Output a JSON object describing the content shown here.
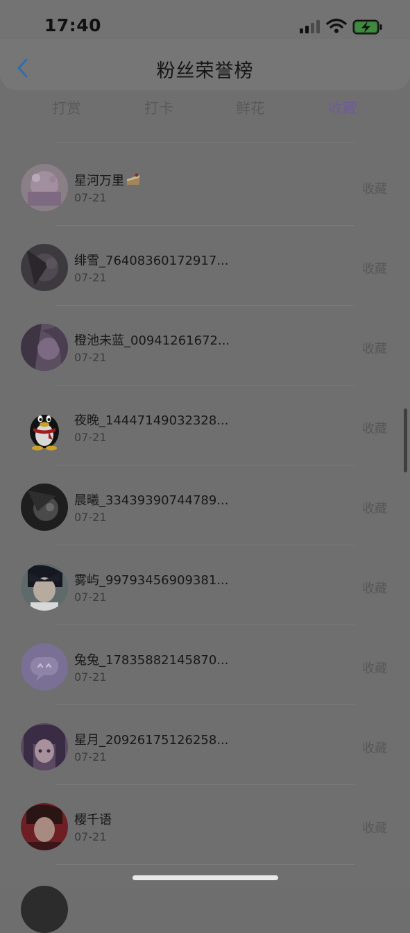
{
  "status_bar": {
    "time": "17:40",
    "icons": [
      "signal-icon",
      "wifi-icon",
      "battery-charging-icon"
    ]
  },
  "header": {
    "title": "粉丝荣誉榜",
    "back_icon": "chevron-left-icon"
  },
  "tabs": [
    {
      "label": "打赏",
      "active": false
    },
    {
      "label": "打卡",
      "active": false
    },
    {
      "label": "鲜花",
      "active": false
    },
    {
      "label": "收藏",
      "active": true
    }
  ],
  "colors": {
    "accent": "#6f5d93",
    "back_icon": "#2b6fb0",
    "page_bg": "#6f6f6f"
  },
  "fans": [
    {
      "name": "星河万里",
      "date": "07-21",
      "action": "收藏",
      "avatar": "pink-anime-avatar",
      "badge": "cake-emoji"
    },
    {
      "name": "绯雪_76408360172917...",
      "date": "07-21",
      "action": "收藏",
      "avatar": "dark-anime-avatar"
    },
    {
      "name": "橙池未蓝_00941261672...",
      "date": "07-21",
      "action": "收藏",
      "avatar": "purple-anime-avatar"
    },
    {
      "name": "夜晚_14447149032328...",
      "date": "07-21",
      "action": "收藏",
      "avatar": "penguin-avatar"
    },
    {
      "name": "晨曦_33439390744789...",
      "date": "07-21",
      "action": "收藏",
      "avatar": "monochrome-anime-avatar"
    },
    {
      "name": "雾屿_99793456909381...",
      "date": "07-21",
      "action": "收藏",
      "avatar": "boy-anime-avatar"
    },
    {
      "name": "兔兔_17835882145870...",
      "date": "07-21",
      "action": "收藏",
      "avatar": "chat-bubble-avatar"
    },
    {
      "name": "星月_20926175126258...",
      "date": "07-21",
      "action": "收藏",
      "avatar": "purple-hair-anime-avatar"
    },
    {
      "name": "樱千语",
      "date": "07-21",
      "action": "收藏",
      "avatar": "red-anime-avatar"
    }
  ]
}
